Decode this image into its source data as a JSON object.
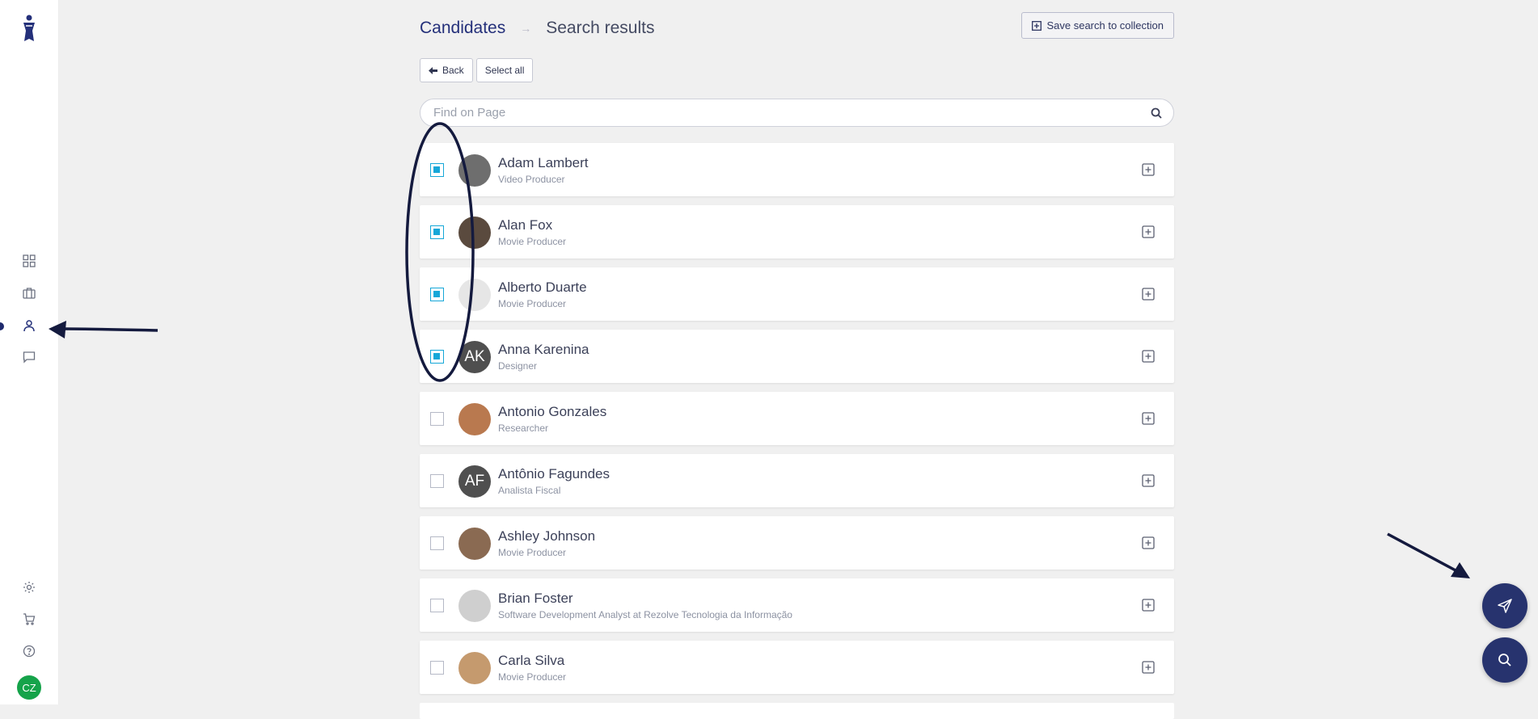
{
  "sidebar": {
    "avatar_initials": "CZ",
    "items": [
      {
        "name": "dashboard",
        "icon": "grid-icon"
      },
      {
        "name": "jobs",
        "icon": "briefcase-icon"
      },
      {
        "name": "candidates",
        "icon": "user-icon",
        "active": true
      },
      {
        "name": "messages",
        "icon": "chat-icon"
      }
    ],
    "bottom": [
      {
        "name": "settings",
        "icon": "gear-icon"
      },
      {
        "name": "cart",
        "icon": "cart-icon"
      },
      {
        "name": "help",
        "icon": "help-icon"
      }
    ]
  },
  "header": {
    "breadcrumb_root": "Candidates",
    "breadcrumb_separator": "→",
    "breadcrumb_current": "Search results",
    "save_label": "Save search to collection"
  },
  "toolbar": {
    "back_label": "Back",
    "select_all_label": "Select all"
  },
  "search": {
    "placeholder": "Find on Page"
  },
  "candidates": [
    {
      "name": "Adam Lambert",
      "role": "Video Producer",
      "checked": true,
      "initials": "",
      "avatar_color": "#6e6e6e"
    },
    {
      "name": "Alan Fox",
      "role": "Movie Producer",
      "checked": true,
      "initials": "",
      "avatar_color": "#5a4a3e"
    },
    {
      "name": "Alberto Duarte",
      "role": "Movie Producer",
      "checked": true,
      "initials": "",
      "avatar_color": "#e6e6e6"
    },
    {
      "name": "Anna Karenina",
      "role": "Designer",
      "checked": true,
      "initials": "AK",
      "avatar_color": "#4f4f4f"
    },
    {
      "name": "Antonio Gonzales",
      "role": "Researcher",
      "checked": false,
      "initials": "",
      "avatar_color": "#b9794f"
    },
    {
      "name": "Antônio Fagundes",
      "role": "Analista Fiscal",
      "checked": false,
      "initials": "AF",
      "avatar_color": "#4f4f4f"
    },
    {
      "name": "Ashley Johnson",
      "role": "Movie Producer",
      "checked": false,
      "initials": "",
      "avatar_color": "#8a6a52"
    },
    {
      "name": "Brian Foster",
      "role": "Software Development Analyst at Rezolve Tecnologia da Informação",
      "checked": false,
      "initials": "",
      "avatar_color": "#cfcfcf"
    },
    {
      "name": "Carla Silva",
      "role": "Movie Producer",
      "checked": false,
      "initials": "",
      "avatar_color": "#c59a6e"
    }
  ],
  "fabs": [
    {
      "name": "send",
      "icon": "send-icon"
    },
    {
      "name": "search",
      "icon": "search-icon"
    }
  ],
  "colors": {
    "accent": "#27336e",
    "checkbox": "#16a7d8",
    "avatar_cz": "#15a34a",
    "annotation": "#141a3e"
  }
}
